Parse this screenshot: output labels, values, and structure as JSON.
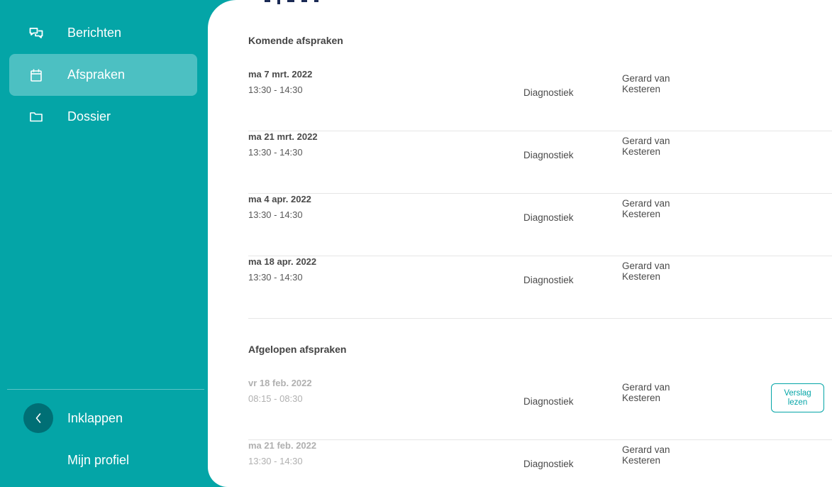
{
  "sidebar": {
    "items": [
      {
        "label": "Berichten",
        "icon": "chat-bubbles-icon",
        "active": false
      },
      {
        "label": "Afspraken",
        "icon": "calendar-icon",
        "active": true
      },
      {
        "label": "Dossier",
        "icon": "folder-icon",
        "active": false
      }
    ],
    "collapse_label": "Inklappen",
    "profile_label": "Mijn profiel"
  },
  "colors": {
    "accent": "#04a5a7",
    "active_item": "#4cc0c2",
    "collapse_circle": "#006f75"
  },
  "upcoming": {
    "title": "Komende afspraken",
    "rows": [
      {
        "date": "ma 7 mrt. 2022",
        "time": "13:30 - 14:30",
        "type": "Diagnostiek",
        "person_line1": "Gerard van",
        "person_line2": "Kesteren"
      },
      {
        "date": "ma 21 mrt. 2022",
        "time": "13:30 - 14:30",
        "type": "Diagnostiek",
        "person_line1": "Gerard van",
        "person_line2": "Kesteren"
      },
      {
        "date": "ma 4 apr. 2022",
        "time": "13:30 - 14:30",
        "type": "Diagnostiek",
        "person_line1": "Gerard van",
        "person_line2": "Kesteren"
      },
      {
        "date": "ma 18 apr. 2022",
        "time": "13:30 - 14:30",
        "type": "Diagnostiek",
        "person_line1": "Gerard van",
        "person_line2": "Kesteren"
      }
    ]
  },
  "past": {
    "title": "Afgelopen afspraken",
    "rows": [
      {
        "date": "vr 18 feb. 2022",
        "time": "08:15 - 08:30",
        "type": "Diagnostiek",
        "person_line1": "Gerard van",
        "person_line2": "Kesteren",
        "report_line1": "Verslag",
        "report_line2": "lezen"
      },
      {
        "date": "ma 21 feb. 2022",
        "time": "13:30 - 14:30",
        "type": "Diagnostiek",
        "person_line1": "Gerard van",
        "person_line2": "Kesteren"
      }
    ]
  }
}
